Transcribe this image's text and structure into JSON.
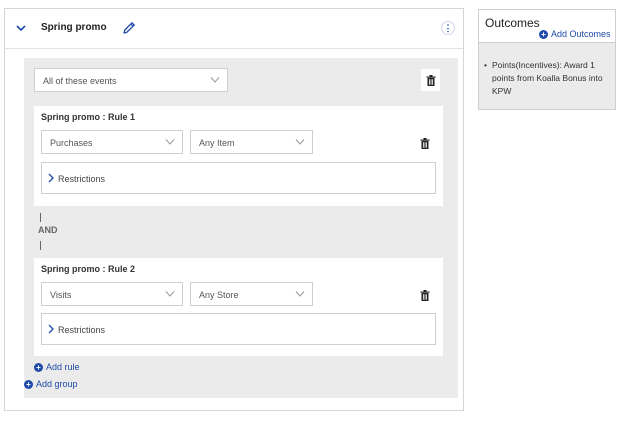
{
  "promo": {
    "title": "Spring promo",
    "match_select": "All of these events"
  },
  "rules": [
    {
      "title": "Spring promo : Rule 1",
      "event": "Purchases",
      "scope": "Any Item",
      "restrictions_label": "Restrictions"
    },
    {
      "title": "Spring promo : Rule 2",
      "event": "Visits",
      "scope": "Any Store",
      "restrictions_label": "Restrictions"
    }
  ],
  "connector": "AND",
  "actions": {
    "add_rule": "Add rule",
    "add_group": "Add group"
  },
  "outcomes": {
    "title": "Outcomes",
    "add_label": "Add Outcomes",
    "items": [
      "Points(Incentives): Award 1 points from Koalla Bonus into KPW"
    ]
  },
  "colors": {
    "accent": "#1f4aa8",
    "panel_gray": "#ebebeb",
    "border": "#cfcfcf"
  }
}
